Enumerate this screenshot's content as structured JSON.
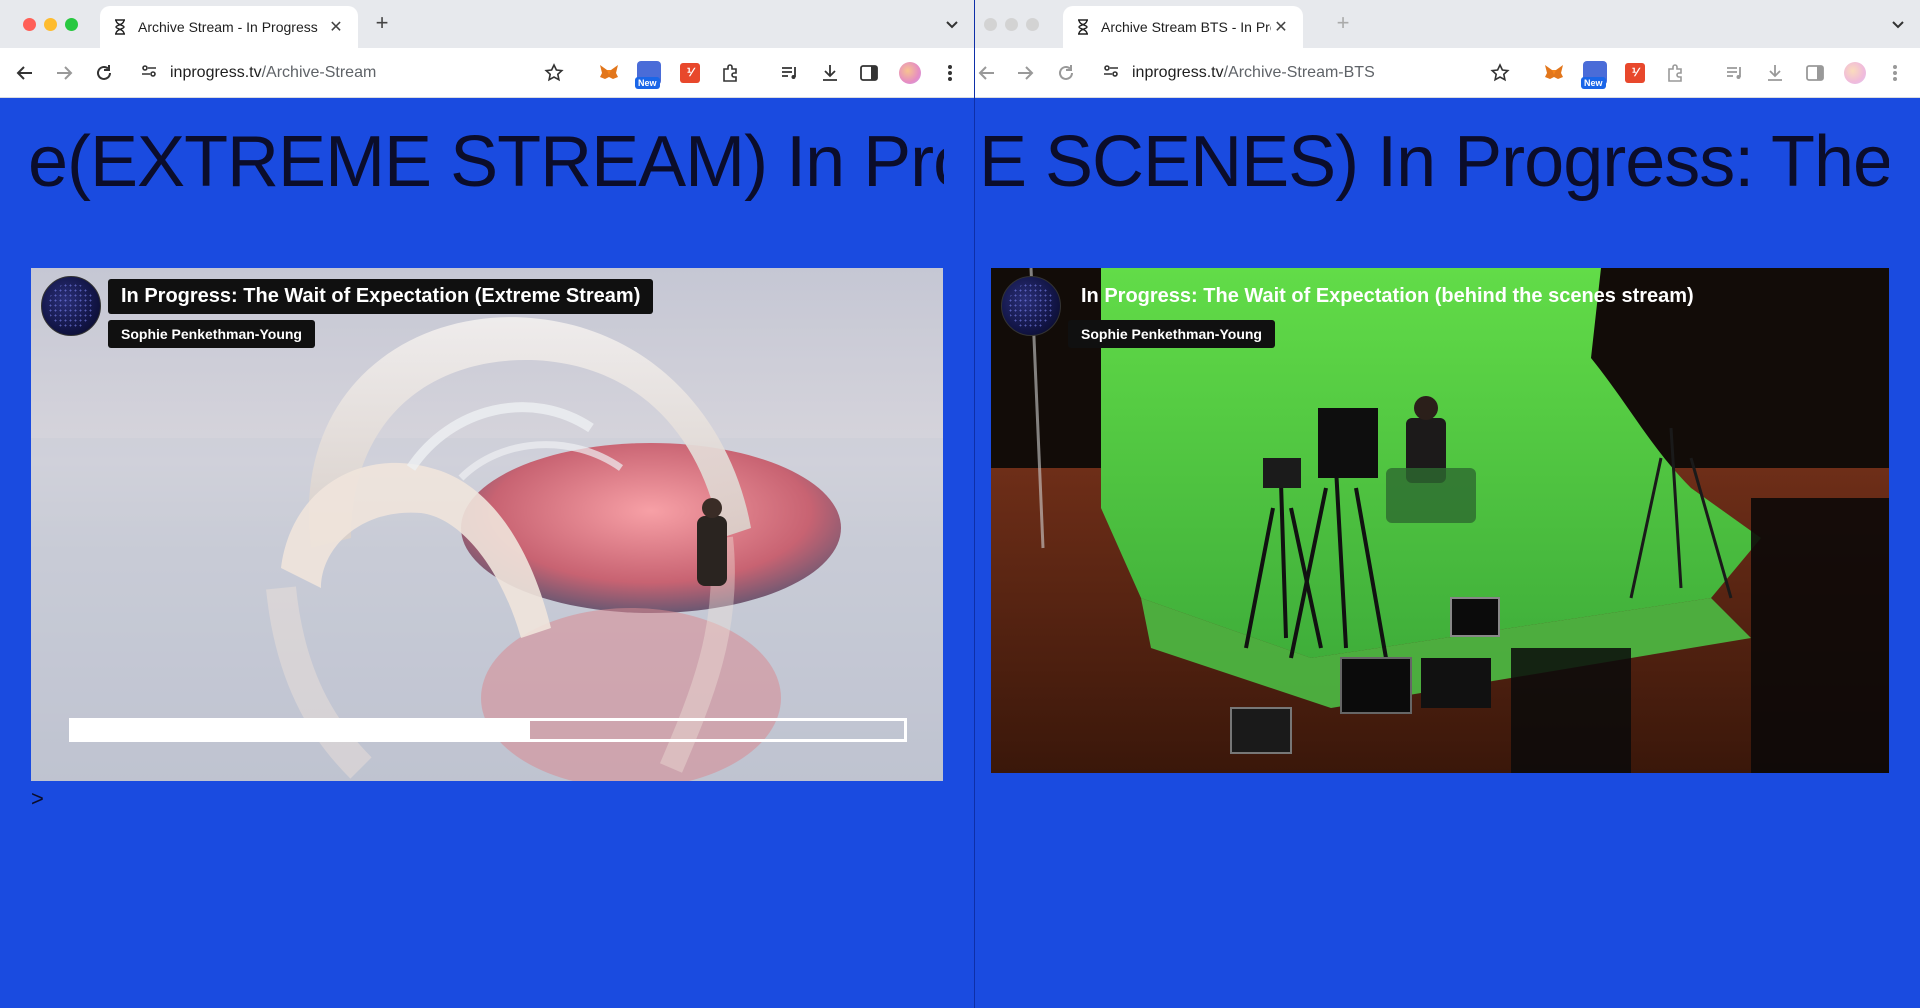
{
  "colors": {
    "page_bg": "#1a4be0",
    "marquee_text": "#0b0d2b",
    "overlay_bg": "#101010"
  },
  "left": {
    "tab": {
      "title": "Archive Stream - In Progress",
      "icon": "hourglass-icon"
    },
    "toolbar": {
      "url_domain": "inprogress.tv",
      "url_path": "/Archive-Stream"
    },
    "extensions": {
      "new_badge": "New"
    },
    "marquee": "e(EXTREME STREAM) In Prog",
    "video": {
      "title": "In Progress: The Wait of Expectation (Extreme Stream)",
      "author": "Sophie Penkethman-Young",
      "progress_fraction": 0.55
    },
    "prompt": ">"
  },
  "right": {
    "tab": {
      "title": "Archive Stream BTS - In Prog",
      "icon": "hourglass-icon"
    },
    "toolbar": {
      "url_domain": "inprogress.tv",
      "url_path": "/Archive-Stream-BTS"
    },
    "extensions": {
      "new_badge": "New"
    },
    "marquee": "E SCENES)  In Progress: The W",
    "video": {
      "title": "In Progress: The Wait of Expectation (behind the scenes stream)",
      "author": "Sophie Penkethman-Young"
    }
  }
}
